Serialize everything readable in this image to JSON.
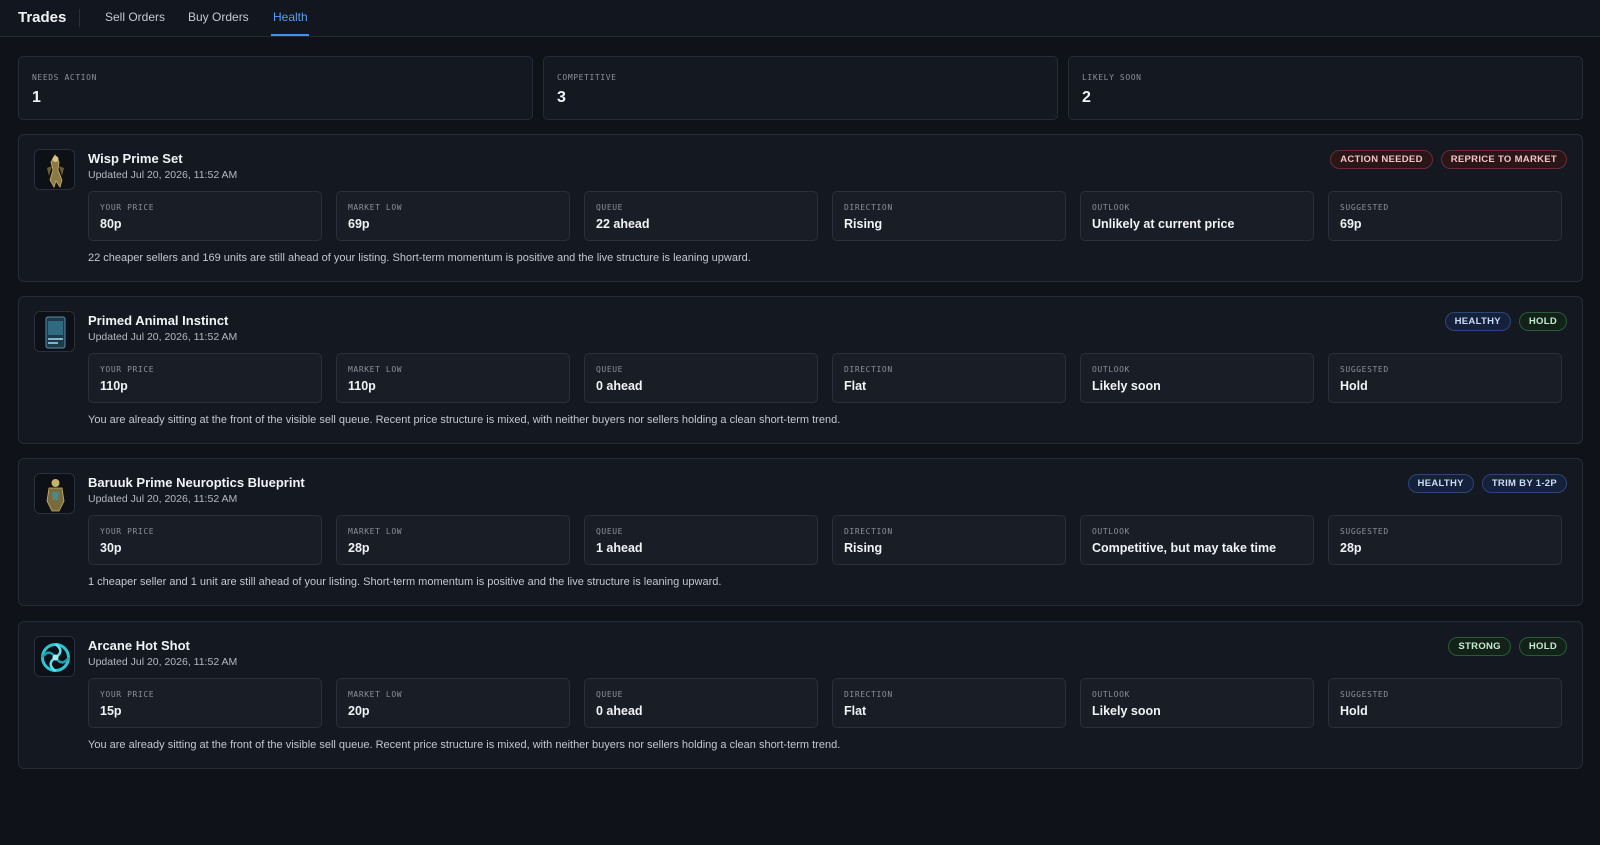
{
  "app": {
    "title": "Trades"
  },
  "tabs": [
    {
      "label": "Sell Orders"
    },
    {
      "label": "Buy Orders"
    },
    {
      "label": "Health"
    }
  ],
  "summary": [
    {
      "label": "NEEDS ACTION",
      "value": "1"
    },
    {
      "label": "COMPETITIVE",
      "value": "3"
    },
    {
      "label": "LIKELY SOON",
      "value": "2"
    }
  ],
  "metric_labels": [
    "YOUR PRICE",
    "MARKET LOW",
    "QUEUE",
    "DIRECTION",
    "OUTLOOK",
    "SUGGESTED"
  ],
  "items": [
    {
      "name": "Wisp Prime Set",
      "updated": "Updated Jul 20, 2026, 11:52 AM",
      "thumb_icon": "wisp-prime-icon",
      "badges": [
        {
          "label": "ACTION NEEDED",
          "tone": "red"
        },
        {
          "label": "REPRICE TO MARKET",
          "tone": "red"
        }
      ],
      "metrics": [
        "80p",
        "69p",
        "22 ahead",
        "Rising",
        "Unlikely at current price",
        "69p"
      ],
      "description": "22 cheaper sellers and 169 units are still ahead of your listing. Short-term momentum is positive and the live structure is leaning upward."
    },
    {
      "name": "Primed Animal Instinct",
      "updated": "Updated Jul 20, 2026, 11:52 AM",
      "thumb_icon": "mod-card-icon",
      "badges": [
        {
          "label": "HEALTHY",
          "tone": "blue"
        },
        {
          "label": "HOLD",
          "tone": "green"
        }
      ],
      "metrics": [
        "110p",
        "110p",
        "0 ahead",
        "Flat",
        "Likely soon",
        "Hold"
      ],
      "description": "You are already sitting at the front of the visible sell queue. Recent price structure is mixed, with neither buyers nor sellers holding a clean short-term trend."
    },
    {
      "name": "Baruuk Prime Neuroptics Blueprint",
      "updated": "Updated Jul 20, 2026, 11:52 AM",
      "thumb_icon": "baruuk-prime-icon",
      "badges": [
        {
          "label": "HEALTHY",
          "tone": "blue"
        },
        {
          "label": "TRIM BY 1-2P",
          "tone": "blue"
        }
      ],
      "metrics": [
        "30p",
        "28p",
        "1 ahead",
        "Rising",
        "Competitive, but may take time",
        "28p"
      ],
      "description": "1 cheaper seller and 1 unit are still ahead of your listing. Short-term momentum is positive and the live structure is leaning upward."
    },
    {
      "name": "Arcane Hot Shot",
      "updated": "Updated Jul 20, 2026, 11:52 AM",
      "thumb_icon": "arcane-icon",
      "badges": [
        {
          "label": "STRONG",
          "tone": "green"
        },
        {
          "label": "HOLD",
          "tone": "green"
        }
      ],
      "metrics": [
        "15p",
        "20p",
        "0 ahead",
        "Flat",
        "Likely soon",
        "Hold"
      ],
      "description": "You are already sitting at the front of the visible sell queue. Recent price structure is mixed, with neither buyers nor sellers holding a clean short-term trend."
    }
  ],
  "colors": {
    "background": "#0f1219",
    "card": "#141821",
    "accent": "#5b9cf0",
    "badge_red": "#f3c4c4",
    "badge_blue": "#c9dcf7",
    "badge_green": "#c7ebcf"
  }
}
